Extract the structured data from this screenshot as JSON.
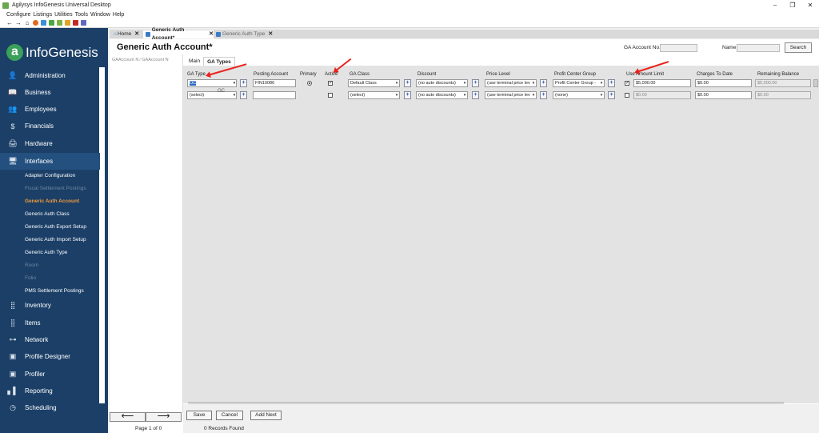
{
  "window": {
    "title": "Agilysys InfoGenesis Universal Desktop",
    "controls": [
      "–",
      "❐",
      "✕"
    ]
  },
  "menu": [
    "Configure",
    "Listings",
    "Utilities",
    "Tools",
    "Window",
    "Help"
  ],
  "logo": {
    "mark": "a",
    "text": "InfoGenesis"
  },
  "sidebar": {
    "items": [
      {
        "label": "Administration",
        "icon": "person-icon",
        "glyph": "👤"
      },
      {
        "label": "Business",
        "icon": "book-icon",
        "glyph": "📖"
      },
      {
        "label": "Employees",
        "icon": "people-icon",
        "glyph": "👥"
      },
      {
        "label": "Financials",
        "icon": "dollar-icon",
        "glyph": "$"
      },
      {
        "label": "Hardware",
        "icon": "printer-icon",
        "glyph": "🖨"
      },
      {
        "label": "Interfaces",
        "icon": "monitor-icon",
        "glyph": "🖥"
      },
      {
        "label": "Inventory",
        "icon": "grid-icon",
        "glyph": "⣿"
      },
      {
        "label": "Items",
        "icon": "grid-icon",
        "glyph": "⣿"
      },
      {
        "label": "Network",
        "icon": "network-icon",
        "glyph": "⊶"
      },
      {
        "label": "Profile Designer",
        "icon": "window-icon",
        "glyph": "▣"
      },
      {
        "label": "Profiler",
        "icon": "window-icon",
        "glyph": "▣"
      },
      {
        "label": "Reporting",
        "icon": "bar-chart-icon",
        "glyph": "▖▌"
      },
      {
        "label": "Scheduling",
        "icon": "clock-icon",
        "glyph": "◷"
      }
    ],
    "sub_items": [
      {
        "label": "Adapter Configuration",
        "state": "normal"
      },
      {
        "label": "Fiscal Settlement Postings",
        "state": "dim"
      },
      {
        "label": "Generic Auth Account",
        "state": "current"
      },
      {
        "label": "Generic Auth Class",
        "state": "normal"
      },
      {
        "label": "Generic Auth Export Setup",
        "state": "normal"
      },
      {
        "label": "Generic Auth Import Setup",
        "state": "normal"
      },
      {
        "label": "Generic Auth Type",
        "state": "normal"
      },
      {
        "label": "Room",
        "state": "dim"
      },
      {
        "label": "Folio",
        "state": "dim"
      },
      {
        "label": "PMS Settlement Postings",
        "state": "normal"
      }
    ]
  },
  "doc_tabs": [
    {
      "label": "Home",
      "active": false,
      "close": "✕"
    },
    {
      "label": "Generic Auth Account*",
      "active": true,
      "close": "✕"
    },
    {
      "label": "Generic Auth Type",
      "active": false,
      "close": "✕"
    }
  ],
  "header": {
    "title": "Generic Auth Account*",
    "ga_account_label": "GA Account No.:",
    "ga_account_value": "",
    "name_label": "Name:",
    "name_value": "",
    "search_label": "Search"
  },
  "left_list": {
    "columns": "GAAccount N  ⁄   GAAccount N"
  },
  "inner_tabs": [
    "Main",
    "GA Types"
  ],
  "grid": {
    "columns": [
      "GA Type",
      "Posting Account",
      "Primary",
      "Active",
      "GA Class",
      "Discount",
      "Price Level",
      "Profit Center Group",
      "Use Amount Limit",
      "Charges To Date",
      "Remaining Balance"
    ],
    "rows": [
      {
        "ga_type": "OC",
        "ga_type_code": "",
        "posting_account": "FIN10086",
        "primary": true,
        "active": true,
        "ga_class": "Default Class",
        "discount": "(no auto discounts)",
        "price_level": "(use terminal price lev",
        "profit_center": "Profit Center Group -",
        "use_limit": true,
        "amount_limit": "$5,000.00",
        "charges": "$0.00",
        "remaining": "$5,000.00"
      },
      {
        "ga_type": "(select)",
        "ga_type_code": "OC",
        "posting_account": "",
        "primary": false,
        "active": false,
        "ga_class": "(select)",
        "discount": "(no auto discounts)",
        "price_level": "(use terminal price lev",
        "profit_center": "(none)",
        "use_limit": false,
        "amount_limit": "$0.00",
        "charges": "$0.00",
        "remaining": "$0.00"
      }
    ]
  },
  "pager": {
    "prev": "⟵",
    "next": "⟶",
    "page_text": "Page 1 of 0"
  },
  "footer": {
    "save": "Save",
    "cancel": "Cancel",
    "add_next": "Add Next",
    "records": "0 Records Found"
  },
  "colors": {
    "sidebar": "#1b3f67",
    "accent": "#f29a3c",
    "annotation": "#e8211b"
  }
}
